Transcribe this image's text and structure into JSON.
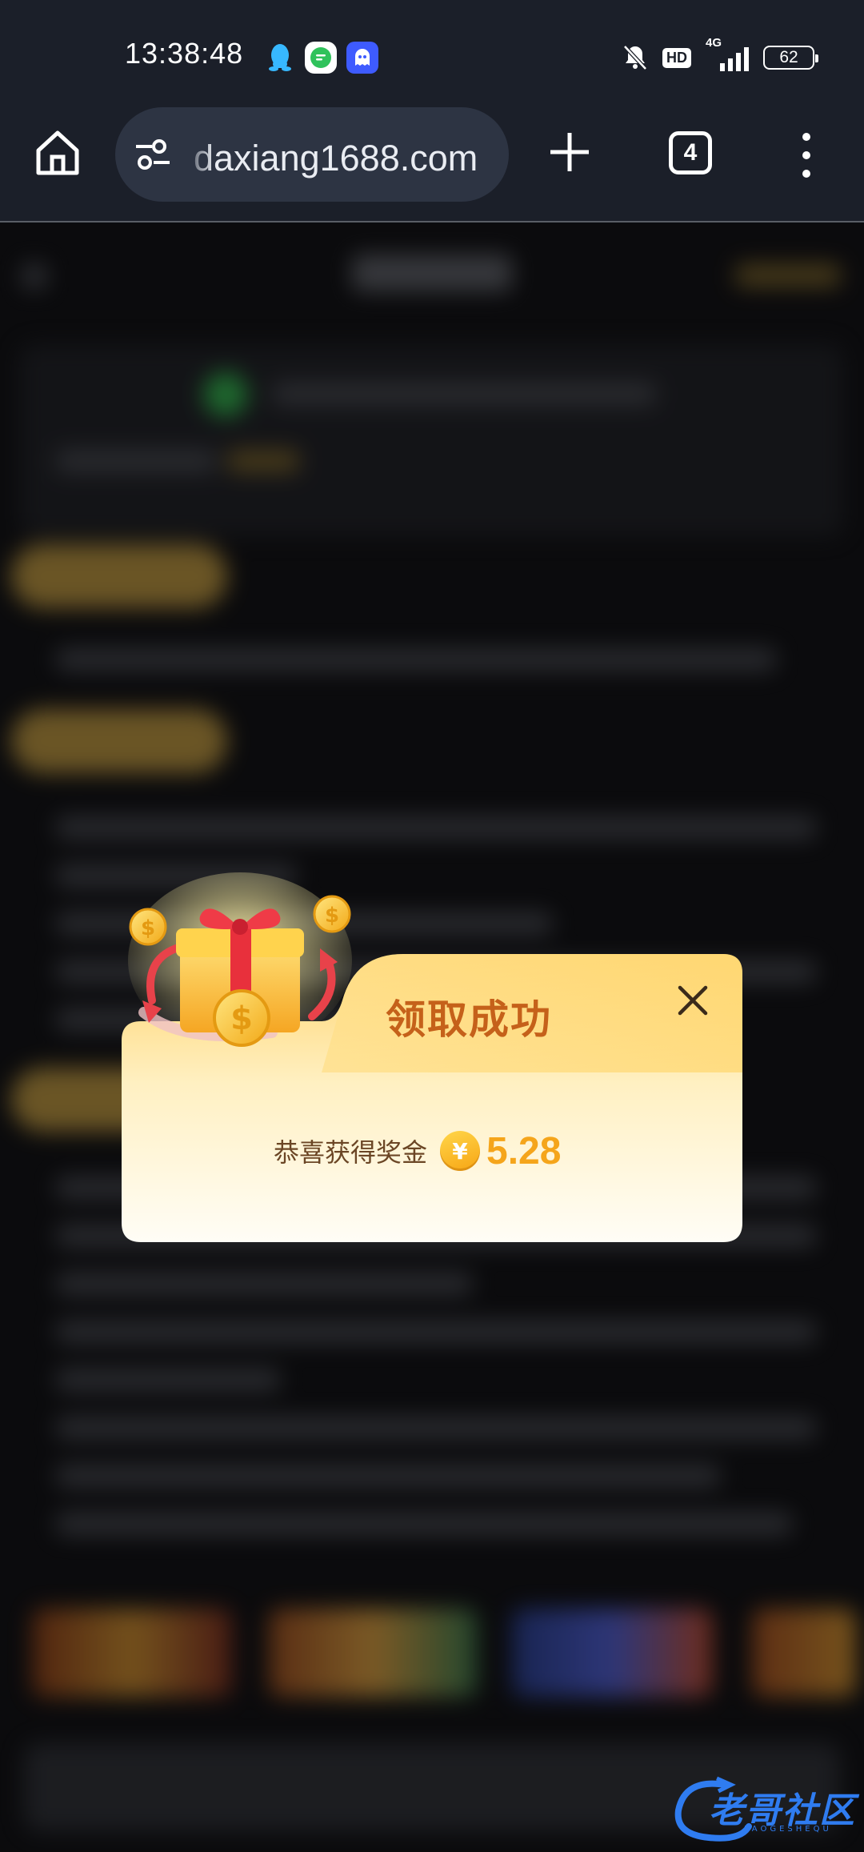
{
  "status_bar": {
    "time": "13:38:48",
    "hd": "HD",
    "network": "4G",
    "battery": "62"
  },
  "browser": {
    "url": "daxiang1688.com",
    "tab_count": "4"
  },
  "dialog": {
    "title": "领取成功",
    "reward_label": "恭喜获得奖金",
    "currency_symbol": "¥",
    "amount": "5.28"
  },
  "watermark": {
    "text": "老哥社区",
    "sub": "LAOGESHEQU"
  },
  "colors": {
    "status_bg": "#1b1f29",
    "url_pill": "#2d3443",
    "dialog_title": "#c5611a",
    "amount": "#f5a51b",
    "watermark": "#2f7cf0"
  }
}
